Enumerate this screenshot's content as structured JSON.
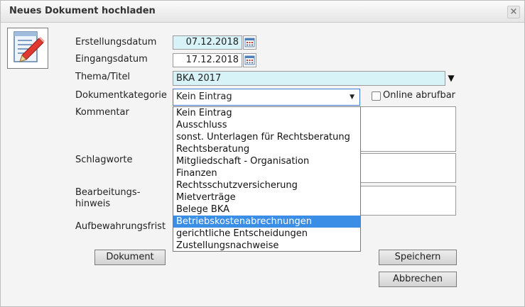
{
  "dialog": {
    "title": "Neues Dokument hochladen",
    "close_glyph": "×"
  },
  "form": {
    "erstellungsdatum_label": "Erstellungsdatum",
    "erstellungsdatum_value": "07.12.2018",
    "eingangsdatum_label": "Eingangsdatum",
    "eingangsdatum_value": "17.12.2018",
    "thema_label": "Thema/Titel",
    "thema_value": "BKA 2017",
    "kategorie_label": "Dokumentkategorie",
    "kategorie_selected": "Kein Eintrag",
    "online_label": "Online abrufbar",
    "online_checked": false,
    "kommentar_label": "Kommentar",
    "schlagworte_label": "Schlagworte",
    "bearbeitung_label_line1": "Bearbeitungs-",
    "bearbeitung_label_line2": "hinweis",
    "aufbewahrung_label": "Aufbewahrungsfrist"
  },
  "dropdown": {
    "highlighted_index": 9,
    "options": [
      "Kein Eintrag",
      "Ausschluss",
      "sonst. Unterlagen für Rechtsberatung",
      "Rechtsberatung",
      "Mitgliedschaft - Organisation",
      "Finanzen",
      "Rechtsschutzversicherung",
      "Mietverträge",
      "Belege BKA",
      "Betriebskostenabrechnungen",
      "gerichtliche Entscheidungen",
      "Zustellungsnachweise"
    ]
  },
  "buttons": {
    "dokument": "Dokument",
    "speichern": "Speichern",
    "abbrechen": "Abbrechen"
  },
  "colors": {
    "date_field_bg": "#d8f3f8",
    "highlight": "#3a8ee6",
    "focus_border": "#3c78d8"
  },
  "icons": {
    "document": "document-edit-icon",
    "calendar": "calendar-icon",
    "close": "close-icon"
  }
}
